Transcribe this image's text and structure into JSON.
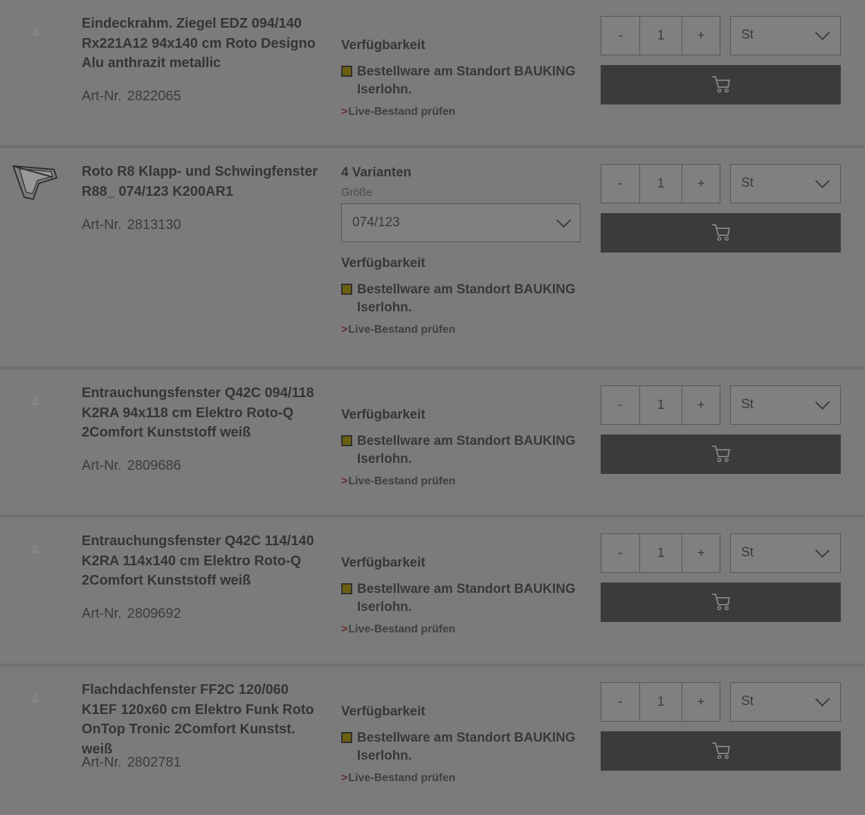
{
  "products": [
    {
      "title": "Eindeckrahm. Ziegel EDZ 094/140 Rx221A12 94x140 cm Roto Designo Alu anthrazit metallic",
      "art_label": "Art-Nr.",
      "art_nr": "2822065",
      "image": "placeholder-icon",
      "variants": null,
      "size_label": null,
      "size_value": null,
      "availability_label": "Verfügbarkeit",
      "status": "Bestellware am Standort BAUKING Iserlohn.",
      "status_color": "#6b6010",
      "live_link": "Live-Bestand prüfen",
      "qty": "1",
      "minus": "-",
      "plus": "+",
      "unit": "St",
      "cart_icon": "cart-icon"
    },
    {
      "title": "Roto R8 Klapp- und Schwingfenster R88_ 074/123 K200AR1",
      "art_label": "Art-Nr.",
      "art_nr": "2813130",
      "image": "roof-window-icon",
      "variants": "4 Varianten",
      "size_label": "Größe",
      "size_value": "074/123",
      "availability_label": "Verfügbarkeit",
      "status": "Bestellware am Standort BAUKING Iserlohn.",
      "status_color": "#6b6010",
      "live_link": "Live-Bestand prüfen",
      "qty": "1",
      "minus": "-",
      "plus": "+",
      "unit": "St",
      "cart_icon": "cart-icon"
    },
    {
      "title": "Entrauchungsfenster Q42C 094/118 K2RA 94x118 cm Elektro Roto-Q 2Comfort Kunststoff weiß",
      "art_label": "Art-Nr.",
      "art_nr": "2809686",
      "image": "placeholder-icon",
      "variants": null,
      "size_label": null,
      "size_value": null,
      "availability_label": "Verfügbarkeit",
      "status": "Bestellware am Standort BAUKING Iserlohn.",
      "status_color": "#6b6010",
      "live_link": "Live-Bestand prüfen",
      "qty": "1",
      "minus": "-",
      "plus": "+",
      "unit": "St",
      "cart_icon": "cart-icon"
    },
    {
      "title": "Entrauchungsfenster Q42C 114/140 K2RA 114x140 cm Elektro Roto-Q 2Comfort Kunststoff weiß",
      "art_label": "Art-Nr.",
      "art_nr": "2809692",
      "image": "placeholder-icon",
      "variants": null,
      "size_label": null,
      "size_value": null,
      "availability_label": "Verfügbarkeit",
      "status": "Bestellware am Standort BAUKING Iserlohn.",
      "status_color": "#6b6010",
      "live_link": "Live-Bestand prüfen",
      "qty": "1",
      "minus": "-",
      "plus": "+",
      "unit": "St",
      "cart_icon": "cart-icon"
    },
    {
      "title": "Flachdachfenster FF2C 120/060 K1EF 120x60 cm Elektro Funk Roto OnTop Tronic 2Comfort Kunstst. weiß",
      "art_label": "Art-Nr.",
      "art_nr": "2802781",
      "image": "placeholder-icon",
      "variants": null,
      "size_label": null,
      "size_value": null,
      "availability_label": "Verfügbarkeit",
      "status": "Bestellware am Standort BAUKING Iserlohn.",
      "status_color": "#6b6010",
      "live_link": "Live-Bestand prüfen",
      "qty": "1",
      "minus": "-",
      "plus": "+",
      "unit": "St",
      "cart_icon": "cart-icon"
    }
  ]
}
